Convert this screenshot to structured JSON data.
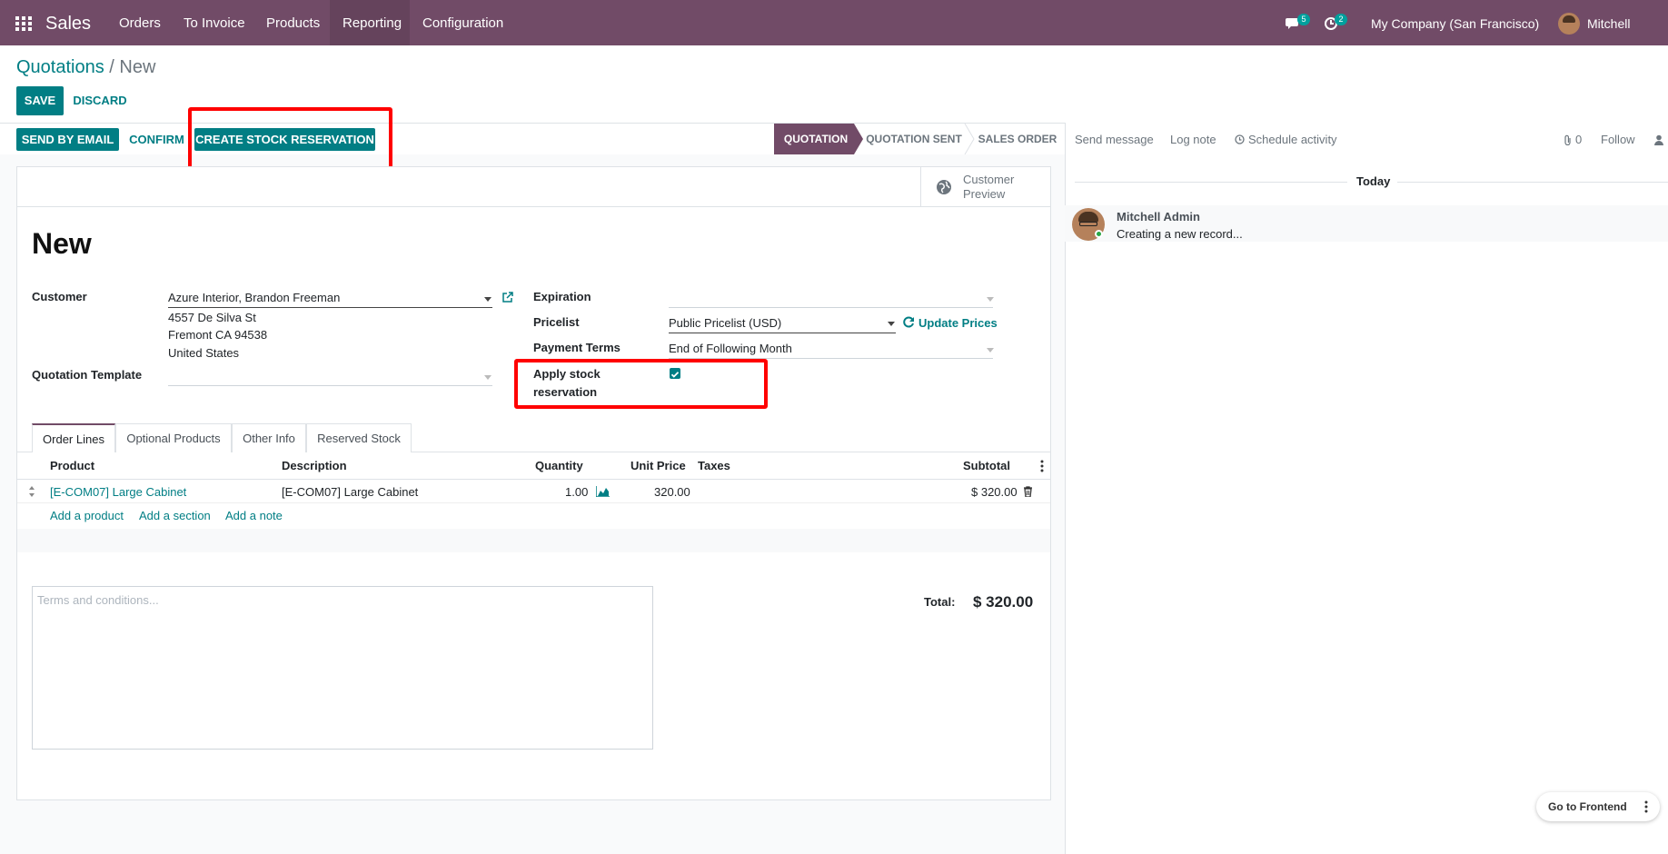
{
  "topbar": {
    "app_name": "Sales",
    "menu": [
      "Orders",
      "To Invoice",
      "Products",
      "Reporting",
      "Configuration"
    ],
    "messages_count": "5",
    "activities_count": "2",
    "company": "My Company (San Francisco)",
    "user": "Mitchell Admin",
    "accent_color": "#714b67"
  },
  "breadcrumb": {
    "parent": "Quotations",
    "separator": "/",
    "current": "New"
  },
  "control": {
    "save": "SAVE",
    "discard": "DISCARD"
  },
  "actions": {
    "send_by_email": "SEND BY EMAIL",
    "confirm": "CONFIRM",
    "create_stock_reservation": "CREATE STOCK RESERVATION"
  },
  "statusbar": {
    "steps": [
      "QUOTATION",
      "QUOTATION SENT",
      "SALES ORDER"
    ],
    "active": "QUOTATION"
  },
  "customer_preview": {
    "line1": "Customer",
    "line2": "Preview"
  },
  "form": {
    "title": "New",
    "customer_label": "Customer",
    "customer_value": "Azure Interior, Brandon Freeman",
    "address": [
      "4557 De Silva St",
      "Fremont CA 94538",
      "United States"
    ],
    "quotation_template_label": "Quotation Template",
    "expiration_label": "Expiration",
    "pricelist_label": "Pricelist",
    "pricelist_value": "Public Pricelist (USD)",
    "update_prices": "Update Prices",
    "payment_terms_label": "Payment Terms",
    "payment_terms_value": "End of Following Month",
    "apply_stock_label_1": "Apply stock",
    "apply_stock_label_2": "reservation",
    "apply_stock_checked": true
  },
  "tabs": [
    "Order Lines",
    "Optional Products",
    "Other Info",
    "Reserved Stock"
  ],
  "order_lines": {
    "headers": {
      "product": "Product",
      "description": "Description",
      "quantity": "Quantity",
      "unit_price": "Unit Price",
      "taxes": "Taxes",
      "subtotal": "Subtotal"
    },
    "rows": [
      {
        "product": "[E-COM07] Large Cabinet",
        "description": "[E-COM07] Large Cabinet",
        "quantity": "1.00",
        "unit_price": "320.00",
        "taxes": "",
        "subtotal": "$ 320.00"
      }
    ],
    "add_product": "Add a product",
    "add_section": "Add a section",
    "add_note": "Add a note"
  },
  "terms_placeholder": "Terms and conditions...",
  "total": {
    "label": "Total:",
    "value": "$ 320.00"
  },
  "chatter": {
    "send_message": "Send message",
    "log_note": "Log note",
    "schedule_activity": "Schedule activity",
    "attachments": "0",
    "follow": "Follow",
    "date_separator": "Today",
    "message_author": "Mitchell Admin",
    "message_body": "Creating a new record..."
  },
  "footer": {
    "go_to_frontend": "Go to Frontend"
  }
}
